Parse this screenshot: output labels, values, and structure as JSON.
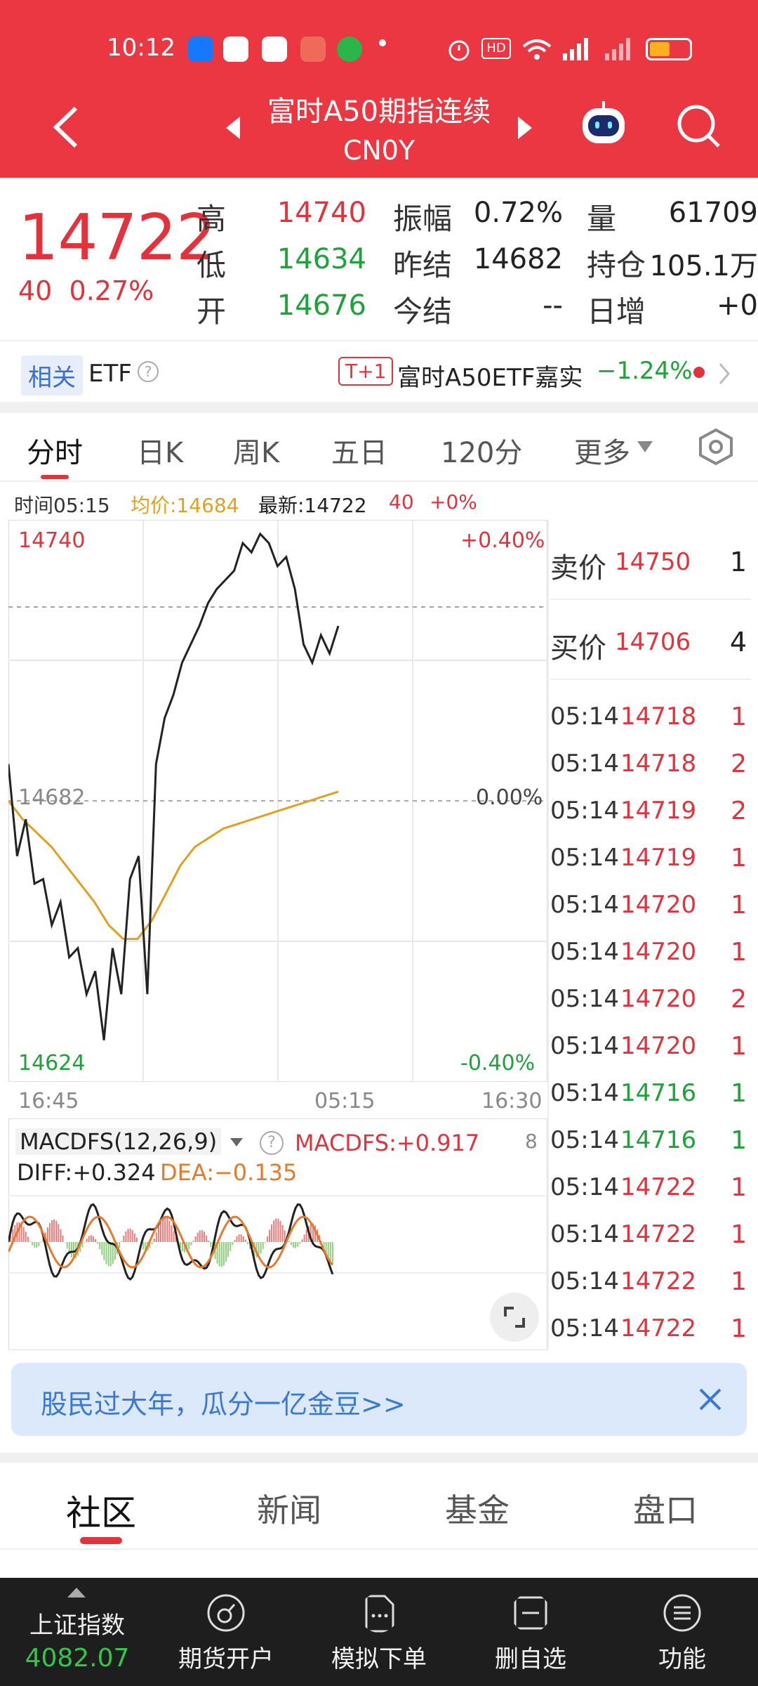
{
  "status": {
    "time": "10:12"
  },
  "header": {
    "title": "富时A50期指连续",
    "code": "CN0Y"
  },
  "quote": {
    "price": "14722",
    "change": "40",
    "change_pct": "0.27%",
    "rows": [
      {
        "l1": "高",
        "v1": "14740",
        "l2": "振幅",
        "v2": "0.72%",
        "l3": "量",
        "v3": "61709"
      },
      {
        "l1": "低",
        "v1": "14634",
        "l2": "昨结",
        "v2": "14682",
        "l3": "持仓",
        "v3": "105.1万"
      },
      {
        "l1": "开",
        "v1": "14676",
        "l2": "今结",
        "v2": "--",
        "l3": "日增",
        "v3": "+0"
      }
    ]
  },
  "etf": {
    "tag": "相关",
    "label": "ETF",
    "t1": "T+1",
    "name": "富时A50ETF嘉实",
    "pct": "−1.24%"
  },
  "tabs": [
    "分时",
    "日K",
    "周K",
    "五日",
    "120分",
    "更多"
  ],
  "chart_info": {
    "time": "时间05:15",
    "avg": "均价:14684",
    "latest": "最新:14722",
    "chg": "40",
    "pct": "+0%"
  },
  "chart_labels": {
    "top_price": "14740",
    "top_pct": "+0.40%",
    "mid_price": "14682",
    "mid_pct": "0.00%",
    "bot_price": "14624",
    "bot_pct": "-0.40%",
    "x_start": "16:45",
    "x_mid": "05:15",
    "x_end": "16:30"
  },
  "macd": {
    "name": "MACDFS(12,26,9)",
    "macdfs": "MACDFS:+0.917",
    "diff": "DIFF:+0.324",
    "dea": "DEA:−0.135",
    "right": "8"
  },
  "orderbook": {
    "ask_label": "卖价",
    "ask_price": "14750",
    "ask_vol": "1",
    "bid_label": "买价",
    "bid_price": "14706",
    "bid_vol": "4",
    "trades": [
      {
        "t": "05:14",
        "p": "14718",
        "v": "1",
        "c": "red"
      },
      {
        "t": "05:14",
        "p": "14718",
        "v": "2",
        "c": "red"
      },
      {
        "t": "05:14",
        "p": "14719",
        "v": "2",
        "c": "red"
      },
      {
        "t": "05:14",
        "p": "14719",
        "v": "1",
        "c": "red"
      },
      {
        "t": "05:14",
        "p": "14720",
        "v": "1",
        "c": "red"
      },
      {
        "t": "05:14",
        "p": "14720",
        "v": "1",
        "c": "red"
      },
      {
        "t": "05:14",
        "p": "14720",
        "v": "2",
        "c": "red"
      },
      {
        "t": "05:14",
        "p": "14720",
        "v": "1",
        "c": "red"
      },
      {
        "t": "05:14",
        "p": "14716",
        "v": "1",
        "c": "green"
      },
      {
        "t": "05:14",
        "p": "14716",
        "v": "1",
        "c": "green"
      },
      {
        "t": "05:14",
        "p": "14722",
        "v": "1",
        "c": "red"
      },
      {
        "t": "05:14",
        "p": "14722",
        "v": "1",
        "c": "red"
      },
      {
        "t": "05:14",
        "p": "14722",
        "v": "1",
        "c": "red"
      },
      {
        "t": "05:14",
        "p": "14722",
        "v": "1",
        "c": "red"
      }
    ]
  },
  "banner": {
    "text": "股民过大年，瓜分一亿金豆>>"
  },
  "bottom_tabs": [
    "社区",
    "新闻",
    "基金",
    "盘口"
  ],
  "bottom_bar": {
    "index_name": "上证指数",
    "index_value": "4082.07",
    "items": [
      "期货开户",
      "模拟下单",
      "删自选",
      "功能"
    ]
  },
  "colors": {
    "brand": "#ea3742",
    "up": "#e2323c",
    "down": "#1fa23a",
    "avg_line": "#e0a020"
  },
  "chart_data": {
    "type": "line",
    "title": "",
    "ylim": [
      14624,
      14740
    ],
    "x_ticks": [
      "16:45",
      "05:15",
      "16:30"
    ],
    "series": [
      {
        "values": [
          14690,
          14670,
          14678,
          14664,
          14665,
          14655,
          14660,
          14648,
          14650,
          14640,
          14645,
          14630,
          14650,
          14640,
          14665,
          14670,
          14640,
          14690,
          14700,
          14705,
          14712,
          14716,
          14720,
          14725,
          14728,
          14730,
          14732,
          14738,
          14736,
          14740,
          14738,
          14733,
          14735,
          14728,
          14716,
          14712,
          14718,
          14714,
          14720
        ]
      },
      {
        "values": [
          14682,
          14678,
          14675,
          14672,
          14668,
          14664,
          14660,
          14655,
          14652,
          14652,
          14656,
          14662,
          14668,
          14672,
          14674,
          14676,
          14677,
          14678,
          14679,
          14680,
          14681,
          14682,
          14683,
          14684
        ]
      }
    ]
  }
}
